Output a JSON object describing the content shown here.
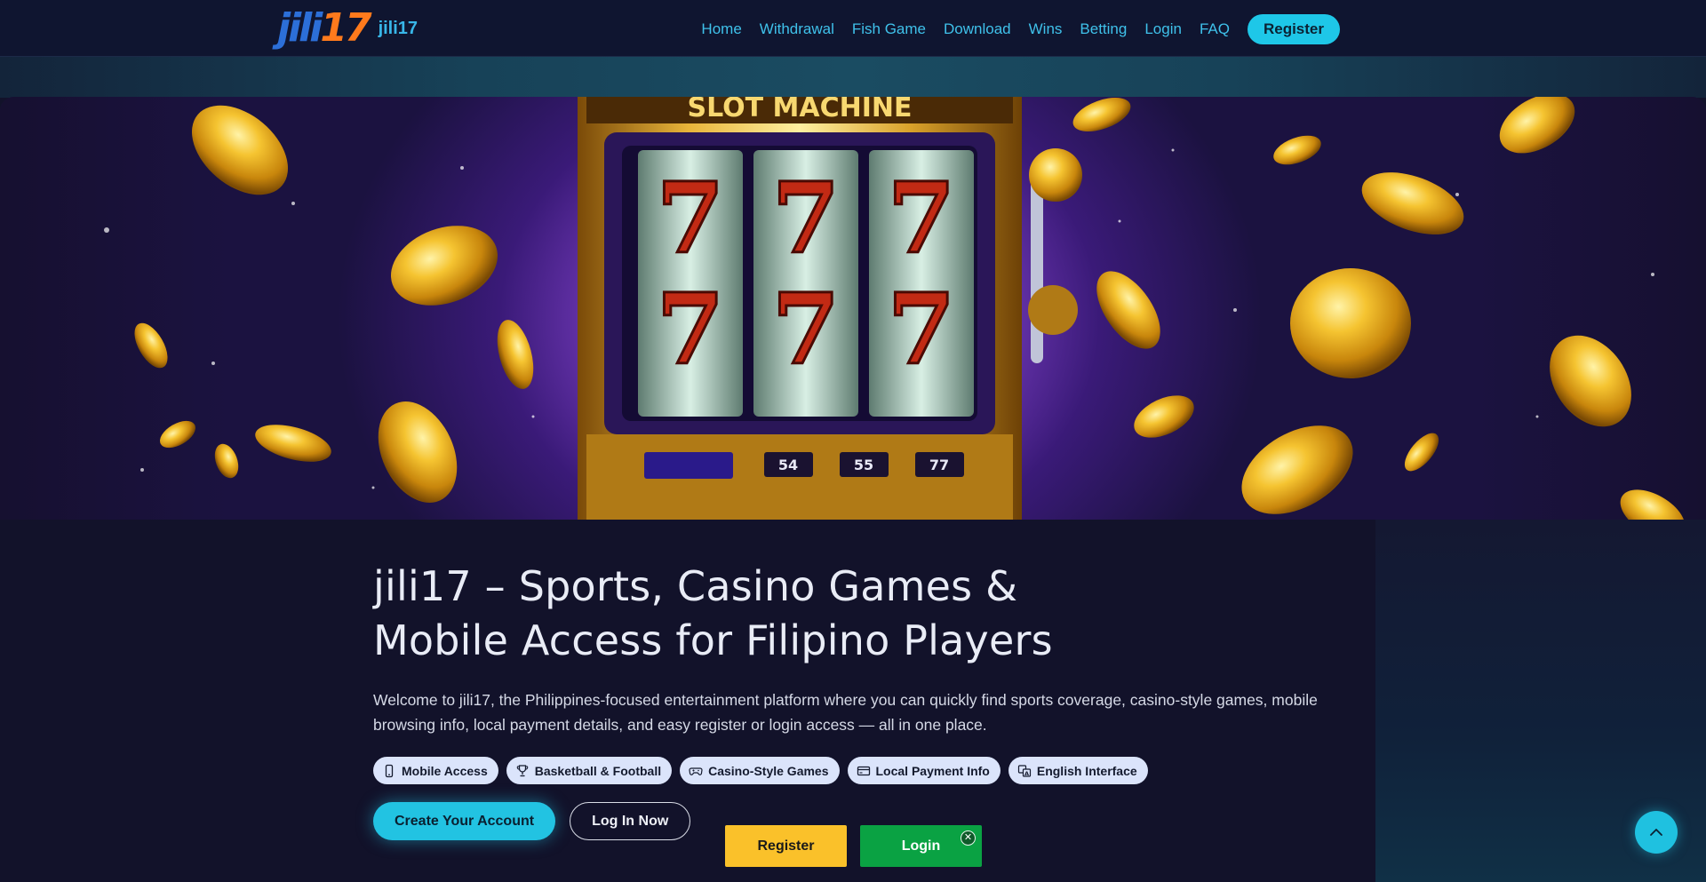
{
  "header": {
    "logo_left": "jili",
    "logo_right": "17",
    "brand_name": "jili17",
    "nav": [
      "Home",
      "Withdrawal",
      "Fish Game",
      "Download",
      "Wins",
      "Betting",
      "Login",
      "FAQ"
    ],
    "register_label": "Register"
  },
  "hero": {
    "sign_text": "SLOT MACHINE",
    "reels": [
      "7",
      "7",
      "7",
      "7",
      "7",
      "7"
    ],
    "panel_labels": [
      "54",
      "55",
      "77"
    ]
  },
  "main": {
    "title_line1": "jili17 – Sports, Casino Games &",
    "title_line2": "Mobile Access for Filipino Players",
    "intro_line1": "Welcome to jili17, the Philippines-focused entertainment platform where you can quickly find sports coverage, casino-style games, mobile",
    "intro_line2": "browsing info, local payment details, and easy register or login access — all in one place.",
    "chips": [
      {
        "label": "Mobile Access",
        "icon": "phone-icon"
      },
      {
        "label": "Basketball & Football",
        "icon": "trophy-icon"
      },
      {
        "label": "Casino-Style Games",
        "icon": "gamepad-icon"
      },
      {
        "label": "Local Payment Info",
        "icon": "card-icon"
      },
      {
        "label": "English Interface",
        "icon": "translate-icon"
      }
    ],
    "cta_primary": "Create Your Account",
    "cta_secondary": "Log In Now"
  },
  "floating_bar": {
    "register_label": "Register",
    "login_label": "Login",
    "close_glyph": "✕"
  },
  "colors": {
    "accent": "#1ec7e8",
    "background": "#12122a",
    "register_yellow": "#fac12a",
    "login_green": "#0aa243",
    "logo_orange": "#ff7a1c",
    "logo_blue": "#2c6fd8"
  }
}
